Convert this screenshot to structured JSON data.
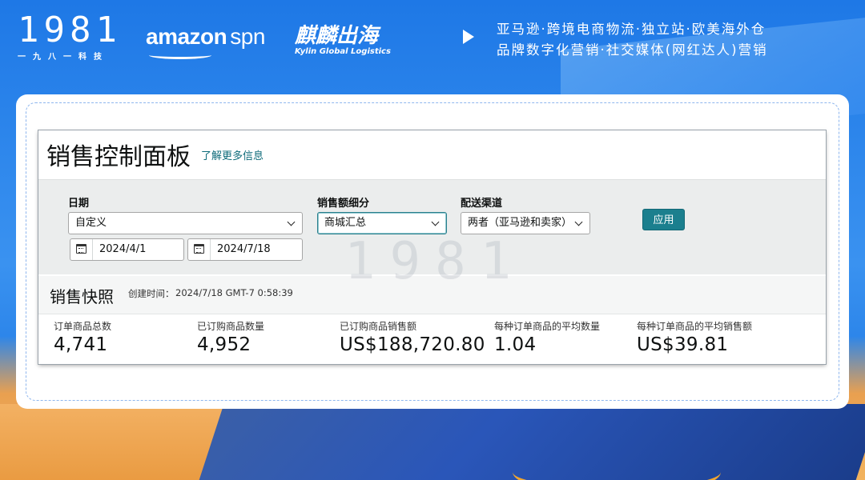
{
  "header": {
    "logo_1981_mark": "1981",
    "logo_1981_sub": "一九八一科技",
    "amazon_logo": "amazon",
    "amazon_spn": "spn",
    "kylin_cn": "麒麟出海",
    "kylin_en": "Kylin Global Logistics",
    "tagline_line1": "亚马逊·跨境电商物流·独立站·欧美海外仓",
    "tagline_line2": "品牌数字化营销·社交媒体(网红达人)营销"
  },
  "dashboard": {
    "title": "销售控制面板",
    "learn_more": "了解更多信息",
    "filters": {
      "date_label": "日期",
      "date_range_value": "自定义",
      "start_date": "2024/4/1",
      "end_date": "2024/7/18",
      "breakdown_label": "销售额细分",
      "breakdown_value": "商城汇总",
      "channel_label": "配送渠道",
      "channel_value": "两者（亚马逊和卖家）",
      "apply_label": "应用"
    },
    "snapshot": {
      "title": "销售快照",
      "created_label": "创建时间：",
      "created_time": "2024/7/18 GMT-7 0:58:39"
    },
    "metrics": [
      {
        "label": "订单商品总数",
        "value": "4,741"
      },
      {
        "label": "已订购商品数量",
        "value": "4,952"
      },
      {
        "label": "已订购商品销售额",
        "value": "US$188,720.80"
      },
      {
        "label": "每种订单商品的平均数量",
        "value": "1.04"
      },
      {
        "label": "每种订单商品的平均销售额",
        "value": "US$39.81"
      }
    ]
  }
}
